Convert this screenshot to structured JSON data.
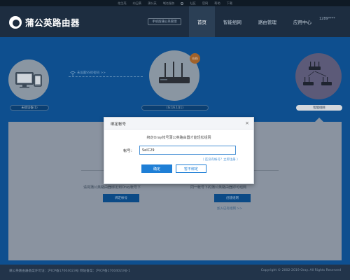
{
  "topbar": {
    "links": [
      "花生壳",
      "向日葵",
      "蒲公英",
      "域名服务",
      "社区",
      "官网",
      "帮助",
      "下载"
    ]
  },
  "header": {
    "logo_text": "蒲公英路由器",
    "web_admin_button": "手机版蒲公英管理",
    "nav": [
      "首页",
      "智能组网",
      "路由管理",
      "应用中心"
    ],
    "user": "1289****"
  },
  "main": {
    "devices_chip": "未接设备(1)",
    "connector_text": "未设置SSID密码 >>",
    "router_chip": "[G:16.1](1)",
    "router_badge": "在线",
    "network_chip": "智能组网",
    "panel": {
      "left_text": "请将蒲公英路由器绑定到Oray帐号下",
      "left_button": "绑定帐号",
      "right_text": "同一帐号下的蒲公英路由器即可组网",
      "right_button": "创建组网",
      "right_link": "加入已有组网 >>"
    }
  },
  "modal": {
    "title": "绑定帐号",
    "close_symbol": "×",
    "description": "绑定Oray帐号蒲公英路由器才能轻松组网",
    "field_label": "帐号：",
    "field_value": "SeIC29",
    "register_link": "（ 还没有帐号？立即注册 ）",
    "ok_button": "确定",
    "cancel_button": "暂不绑定"
  },
  "footer": {
    "left": "蒲公英路由器备案许可证：沪ICP备17004023号 网站备案：沪ICP备17004023号-1",
    "right": "Copyright © 2002-2019 Oray. All Rights Reserved"
  },
  "colors": {
    "modal_accent": "#1f7fd6",
    "header_bg": "#1d2d40",
    "main_bg_dimmed": "#0e4f8f"
  }
}
